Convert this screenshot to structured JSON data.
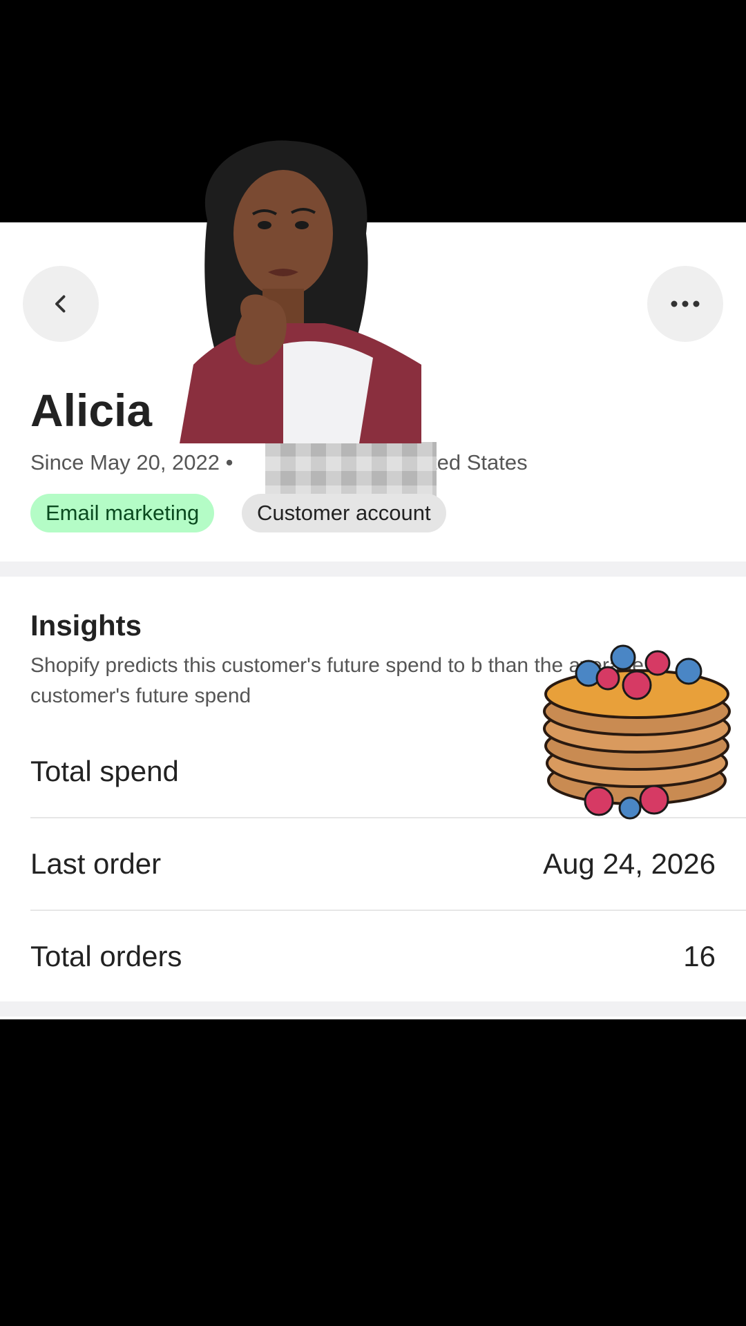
{
  "header": {
    "back_icon": "chevron-left-icon",
    "more_icon": "more-horizontal-icon"
  },
  "customer": {
    "name": "Alicia",
    "since": "Since May 20, 2022 •",
    "location_suffix": "ted States",
    "badges": [
      "Email marketing",
      "Customer account"
    ]
  },
  "insights": {
    "title": "Insights",
    "description": "Shopify predicts this customer's future spend to b than the average customer's future spend"
  },
  "stats": [
    {
      "label": "Total spend",
      "value": ""
    },
    {
      "label": "Last order",
      "value": "Aug 24, 2026"
    },
    {
      "label": "Total orders",
      "value": "16"
    }
  ],
  "colors": {
    "email_badge_bg": "#b4fcc6",
    "account_badge_bg": "#e5e5e5",
    "panel_bg": "#ffffff",
    "band_bg": "#f1f1f3"
  }
}
